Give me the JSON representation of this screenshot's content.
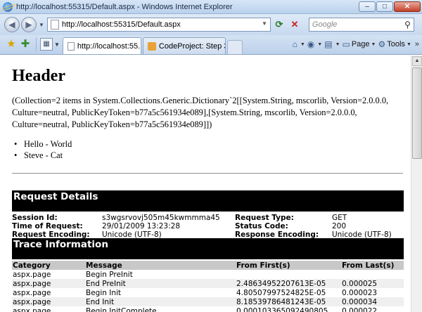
{
  "window": {
    "title": "http://localhost:55315/Default.aspx - Windows Internet Explorer",
    "minimize": "–",
    "maximize": "□",
    "close": "✕"
  },
  "address_bar": {
    "url": "http://localhost:55315/Default.aspx",
    "search_placeholder": "Google"
  },
  "tabs": [
    {
      "label": "http://localhost:55...",
      "active": true
    },
    {
      "label": "CodeProject: Step 3 ...",
      "active": false
    }
  ],
  "command_bar": {
    "page_label": "Page",
    "tools_label": "Tools"
  },
  "page": {
    "header": "Header",
    "collection_text": "(Collection=2 items in System.Collections.Generic.Dictionary`2[[System.String, mscorlib, Version=2.0.0.0, Culture=neutral, PublicKeyToken=b77a5c561934e089],[System.String, mscorlib, Version=2.0.0.0, Culture=neutral, PublicKeyToken=b77a5c561934e089]])",
    "items": [
      "Hello - World",
      "Steve - Cat"
    ]
  },
  "request_details": {
    "title": "Request Details",
    "session_id_label": "Session Id:",
    "session_id": "s3wgsrvovj505m45kwmmma45",
    "request_type_label": "Request Type:",
    "request_type": "GET",
    "time_label": "Time of Request:",
    "time": "29/01/2009 13:23:28",
    "status_code_label": "Status Code:",
    "status_code": "200",
    "request_encoding_label": "Request Encoding:",
    "request_encoding": "Unicode (UTF-8)",
    "response_encoding_label": "Response Encoding:",
    "response_encoding": "Unicode (UTF-8)"
  },
  "trace": {
    "title": "Trace Information",
    "columns": [
      "Category",
      "Message",
      "From First(s)",
      "From Last(s)"
    ],
    "rows": [
      [
        "aspx.page",
        "Begin PreInit",
        "",
        ""
      ],
      [
        "aspx.page",
        "End PreInit",
        "2.48634952207613E-05",
        "0.000025"
      ],
      [
        "aspx.page",
        "Begin Init",
        "4.80507997524825E-05",
        "0.000023"
      ],
      [
        "aspx.page",
        "End Init",
        "8.18539786481243E-05",
        "0.000034"
      ],
      [
        "aspx.page",
        "Begin InitComplete",
        "0.000103365092490805",
        "0.000022"
      ]
    ]
  }
}
